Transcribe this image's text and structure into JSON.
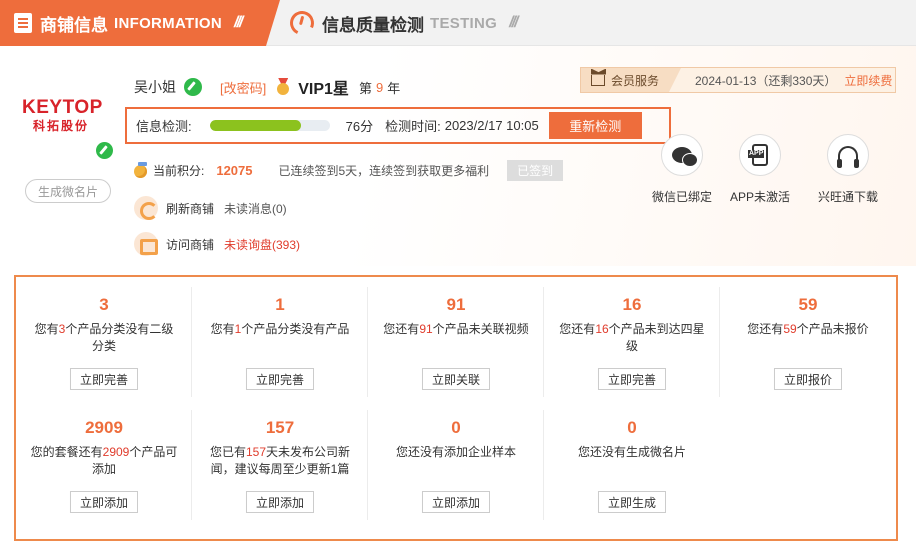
{
  "tabs": [
    {
      "title": "商铺信息",
      "sub": "INFORMATION",
      "slash": "///"
    },
    {
      "title": "信息质量检测",
      "sub": "TESTING",
      "slash": "///"
    }
  ],
  "company": {
    "logo_text": "KEYTOP",
    "logo_sub": "科拓股份",
    "card_button": "生成微名片"
  },
  "user": {
    "name": "吴小姐",
    "change_password": "[改密码]",
    "vip": "VIP1星",
    "rank_prefix": "第",
    "rank": "9",
    "rank_suffix": "年"
  },
  "member": {
    "label": "会员服务",
    "date": "2024-01-13（还剩330天）",
    "renew": "立即续费"
  },
  "detection": {
    "label": "信息检测:",
    "score": "76分",
    "progress": 0.76,
    "time_label": "检测时间:",
    "time": "2023/2/17 10:05",
    "recheck": "重新检测"
  },
  "points": {
    "label": "当前积分:",
    "value": "12075",
    "message": "已连续签到5天，连续签到获取更多福利",
    "signed": "已签到"
  },
  "refresh": {
    "label": "刷新商铺",
    "value": "未读消息(0)"
  },
  "visit": {
    "label": "访问商铺",
    "value": "未读询盘(393)"
  },
  "quick": [
    {
      "icon": "wechat-icon",
      "label": "微信已绑定"
    },
    {
      "icon": "app-icon",
      "label": "APP未激活"
    },
    {
      "icon": "headset-icon",
      "label": "兴旺通下载"
    }
  ],
  "tasks": [
    {
      "num": "3",
      "pre": "您有",
      "hl": "3",
      "post": "个产品分类没有二级分类",
      "button": "立即完善"
    },
    {
      "num": "1",
      "pre": "您有",
      "hl": "1",
      "post": "个产品分类没有产品",
      "button": "立即完善"
    },
    {
      "num": "91",
      "pre": "您还有",
      "hl": "91",
      "post": "个产品未关联视频",
      "button": "立即关联"
    },
    {
      "num": "16",
      "pre": "您还有",
      "hl": "16",
      "post": "个产品未到达四星级",
      "button": "立即完善"
    },
    {
      "num": "59",
      "pre": "您还有",
      "hl": "59",
      "post": "个产品未报价",
      "button": "立即报价"
    },
    {
      "num": "2909",
      "pre": "您的套餐还有",
      "hl": "2909",
      "post": "个产品可添加",
      "button": "立即添加"
    },
    {
      "num": "157",
      "pre": "您已有",
      "hl": "157",
      "post": "天未发布公司新闻，建议每周至少更新1篇",
      "button": "立即添加"
    },
    {
      "num": "0",
      "pre": "您还没有添加企业样本",
      "hl": "",
      "post": "",
      "button": "立即添加"
    },
    {
      "num": "0",
      "pre": "您还没有生成微名片",
      "hl": "",
      "post": "",
      "button": "立即生成"
    }
  ]
}
